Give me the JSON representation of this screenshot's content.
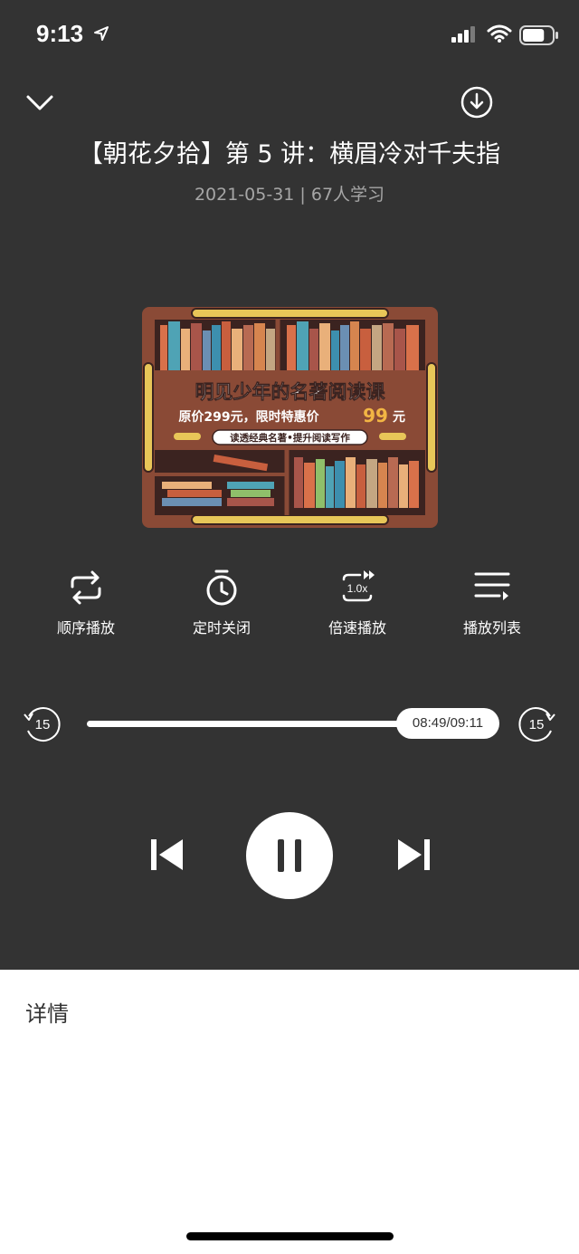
{
  "status_bar": {
    "time": "9:13",
    "battery_level": 0.75
  },
  "header": {
    "title": "【朝花夕拾】第 5 讲：横眉冷对千夫指",
    "meta": "2021-05-31 | 67人学习"
  },
  "cover": {
    "headline": "明见少年的名著阅读课",
    "price_prefix": "原价299元，限时特惠价",
    "price_value": "99",
    "price_suffix": "元",
    "tagline": "读透经典名著•提升阅读写作"
  },
  "controls": {
    "order": "顺序播放",
    "timer": "定时关闭",
    "speed": "倍速播放",
    "speed_value": "1.0x",
    "playlist": "播放列表"
  },
  "progress": {
    "time_label": "08:49/09:11",
    "fraction": 0.96,
    "skip_back": "15",
    "skip_forward": "15"
  },
  "details": {
    "label": "详情"
  },
  "colors": {
    "player_bg": "#333333",
    "accent_price": "#f2b544",
    "shelf": "#8a4a36"
  }
}
